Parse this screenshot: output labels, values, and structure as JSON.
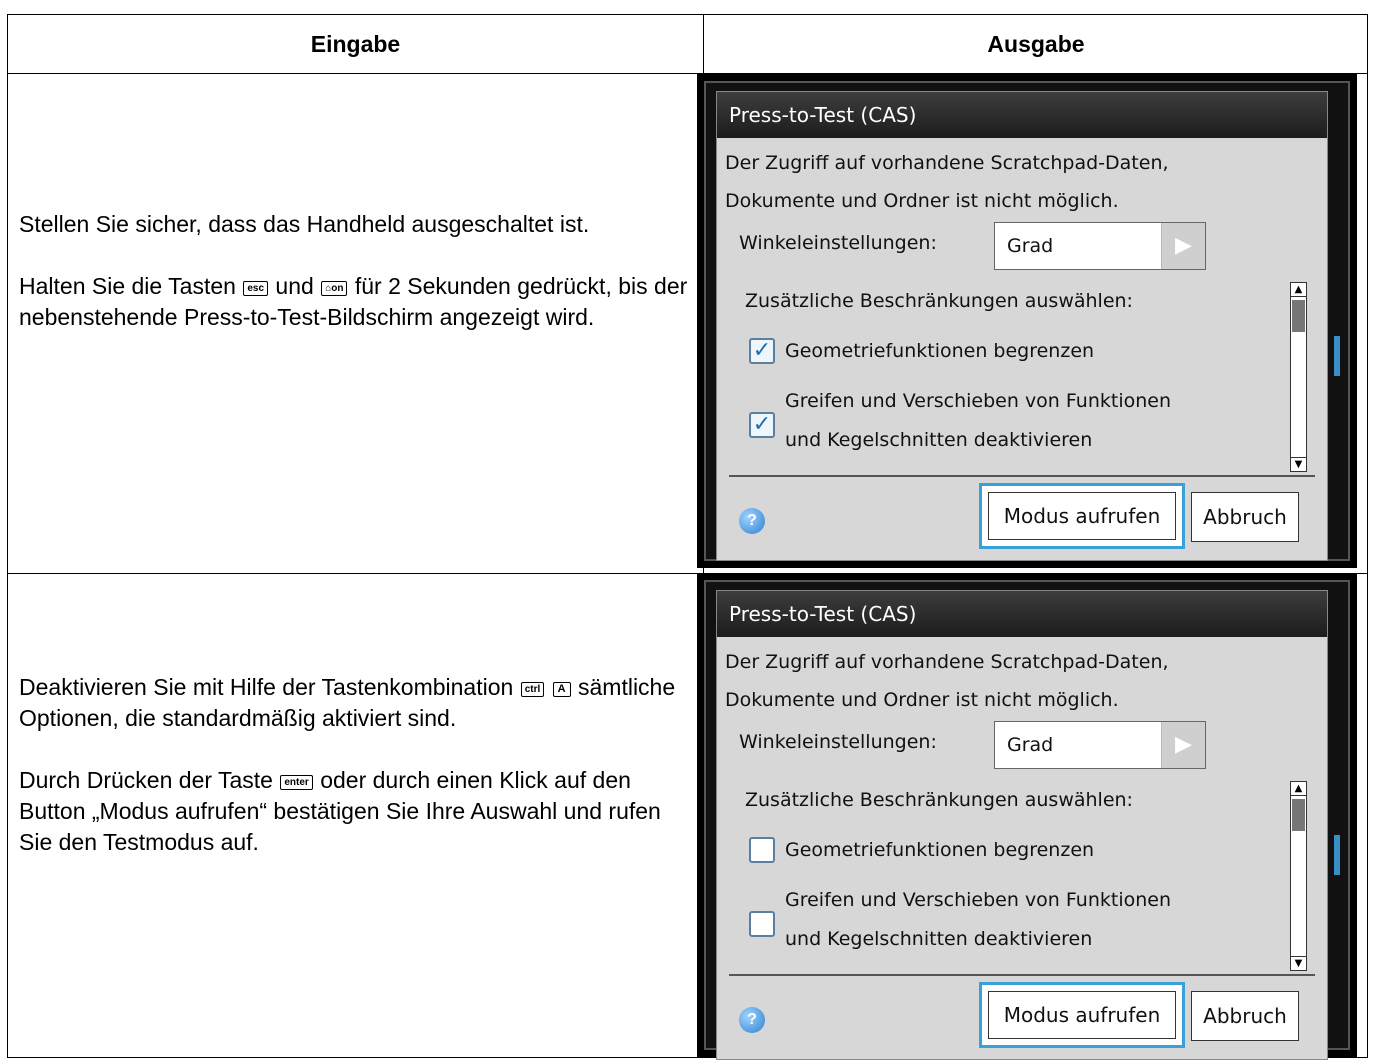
{
  "header": {
    "col1": "Eingabe",
    "col2": "Ausgabe"
  },
  "row1": {
    "p1": "Stellen Sie sicher, dass das Handheld ausgeschaltet ist.",
    "p2_a": "Halten Sie die Tasten",
    "key_esc": "esc",
    "p2_b": "und",
    "key_on": "⌂on",
    "p2_c": "für 2 Sekunden gedrückt, bis der nebenstehende Press-to-Test-Bildschirm angezeigt wird."
  },
  "row2": {
    "p1_a": "Deaktivieren Sie mit Hilfe der Tastenkombination",
    "key_ctrl": "ctrl",
    "key_a": "A",
    "p1_b": "sämtliche Optionen, die standardmäßig aktiviert sind.",
    "p2_a": "Durch Drücken der Taste",
    "key_enter": "enter",
    "p2_b": "oder durch einen Klick auf den Button „Modus aufrufen“ bestätigen Sie Ihre Auswahl und rufen Sie den Testmodus auf."
  },
  "screen1": {
    "title": "Press-to-Test (CAS)",
    "info_line1": "Der Zugriff auf vorhandene Scratchpad-Daten,",
    "info_line2": "Dokumente und Ordner ist nicht möglich.",
    "angle_label": "Winkeleinstellungen:",
    "angle_value": "Grad",
    "restrictions_label": "Zusätzliche Beschränkungen auswählen:",
    "option1": "Geometriefunktionen begrenzen",
    "option1_checked": true,
    "option2_line1": "Greifen und Verschieben von Funktionen",
    "option2_line2": "und Kegelschnitten deaktivieren",
    "option2_checked": true,
    "enter_button": "Modus aufrufen",
    "cancel_button": "Abbruch",
    "check_mark": "✓"
  },
  "screen2": {
    "title": "Press-to-Test (CAS)",
    "info_line1": "Der Zugriff auf vorhandene Scratchpad-Daten,",
    "info_line2": "Dokumente und Ordner ist nicht möglich.",
    "angle_label": "Winkeleinstellungen:",
    "angle_value": "Grad",
    "restrictions_label": "Zusätzliche Beschränkungen auswählen:",
    "option1": "Geometriefunktionen begrenzen",
    "option1_checked": false,
    "option2_line1": "Greifen und Verschieben von Funktionen",
    "option2_line2": "und Kegelschnitten deaktivieren",
    "option2_checked": false,
    "enter_button": "Modus aufrufen",
    "cancel_button": "Abbruch",
    "check_mark": ""
  },
  "icons": {
    "help": "?",
    "dropdown_arrow": "▶",
    "scroll_up": "▲",
    "scroll_down": "▼"
  }
}
